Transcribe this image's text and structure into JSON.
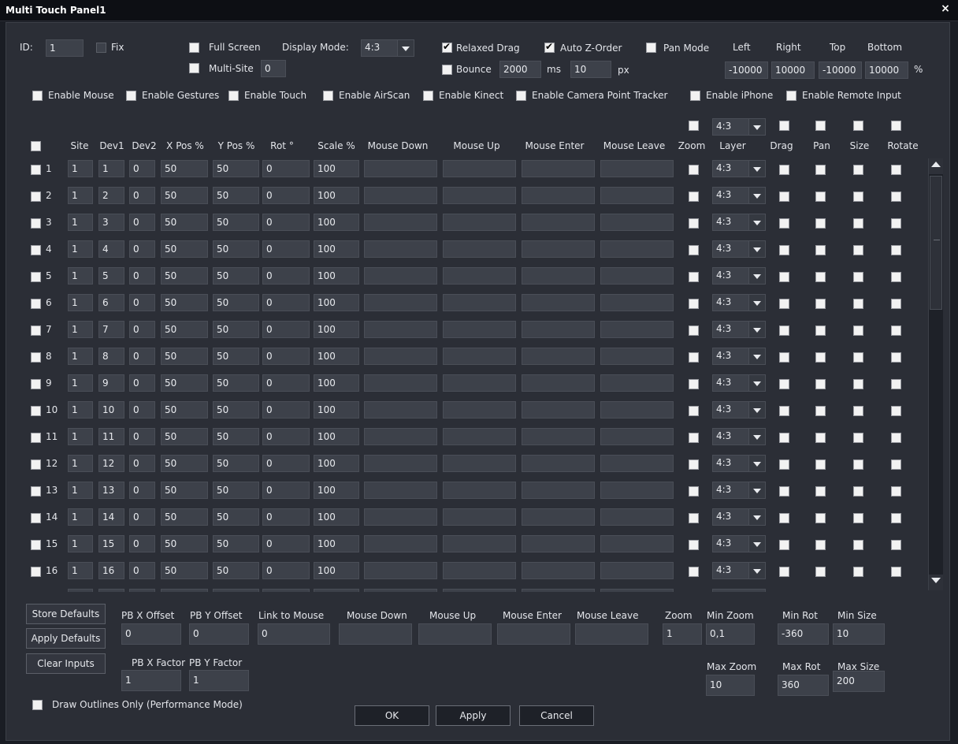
{
  "window": {
    "title": "Multi Touch Panel1",
    "close_glyph": "×"
  },
  "top": {
    "id_label": "ID:",
    "id_value": "1",
    "fix_label": "Fix",
    "full_screen_label": "Full Screen",
    "display_mode_label": "Display Mode:",
    "display_mode_value": "4:3",
    "multi_site_label": "Multi-Site",
    "multi_site_value": "0",
    "relaxed_drag_label": "Relaxed Drag",
    "relaxed_drag_checked": true,
    "auto_z_order_label": "Auto Z-Order",
    "auto_z_order_checked": true,
    "pan_mode_label": "Pan Mode",
    "bounce_label": "Bounce",
    "bounce_ms_value": "2000",
    "ms_label": "ms",
    "bounce_px_value": "10",
    "px_label": "px",
    "left_label": "Left",
    "right_label": "Right",
    "top_label": "Top",
    "bottom_label": "Bottom",
    "left_value": "-10000",
    "right_value": "10000",
    "top_value": "-10000",
    "bottom_value": "10000",
    "percent_label": "%"
  },
  "enable_options": [
    "Enable Mouse",
    "Enable Gestures",
    "Enable Touch",
    "Enable AirScan",
    "Enable Kinect",
    "Enable Camera Point Tracker",
    "Enable iPhone",
    "Enable Remote Input"
  ],
  "table": {
    "header_layer_value": "4:3",
    "columns": [
      "Site",
      "Dev1",
      "Dev2",
      "X Pos %",
      "Y Pos %",
      "Rot °",
      "Scale %",
      "Mouse Down",
      "Mouse Up",
      "Mouse Enter",
      "Mouse Leave",
      "Zoom",
      "Layer",
      "Drag",
      "Pan",
      "Size",
      "Rotate"
    ],
    "rows": [
      {
        "n": "1",
        "site": "1",
        "dev1": "1",
        "dev2": "0",
        "x": "50",
        "y": "50",
        "rot": "0",
        "scale": "100",
        "layer": "4:3"
      },
      {
        "n": "2",
        "site": "1",
        "dev1": "2",
        "dev2": "0",
        "x": "50",
        "y": "50",
        "rot": "0",
        "scale": "100",
        "layer": "4:3"
      },
      {
        "n": "3",
        "site": "1",
        "dev1": "3",
        "dev2": "0",
        "x": "50",
        "y": "50",
        "rot": "0",
        "scale": "100",
        "layer": "4:3"
      },
      {
        "n": "4",
        "site": "1",
        "dev1": "4",
        "dev2": "0",
        "x": "50",
        "y": "50",
        "rot": "0",
        "scale": "100",
        "layer": "4:3"
      },
      {
        "n": "5",
        "site": "1",
        "dev1": "5",
        "dev2": "0",
        "x": "50",
        "y": "50",
        "rot": "0",
        "scale": "100",
        "layer": "4:3"
      },
      {
        "n": "6",
        "site": "1",
        "dev1": "6",
        "dev2": "0",
        "x": "50",
        "y": "50",
        "rot": "0",
        "scale": "100",
        "layer": "4:3"
      },
      {
        "n": "7",
        "site": "1",
        "dev1": "7",
        "dev2": "0",
        "x": "50",
        "y": "50",
        "rot": "0",
        "scale": "100",
        "layer": "4:3"
      },
      {
        "n": "8",
        "site": "1",
        "dev1": "8",
        "dev2": "0",
        "x": "50",
        "y": "50",
        "rot": "0",
        "scale": "100",
        "layer": "4:3"
      },
      {
        "n": "9",
        "site": "1",
        "dev1": "9",
        "dev2": "0",
        "x": "50",
        "y": "50",
        "rot": "0",
        "scale": "100",
        "layer": "4:3"
      },
      {
        "n": "10",
        "site": "1",
        "dev1": "10",
        "dev2": "0",
        "x": "50",
        "y": "50",
        "rot": "0",
        "scale": "100",
        "layer": "4:3"
      },
      {
        "n": "11",
        "site": "1",
        "dev1": "11",
        "dev2": "0",
        "x": "50",
        "y": "50",
        "rot": "0",
        "scale": "100",
        "layer": "4:3"
      },
      {
        "n": "12",
        "site": "1",
        "dev1": "12",
        "dev2": "0",
        "x": "50",
        "y": "50",
        "rot": "0",
        "scale": "100",
        "layer": "4:3"
      },
      {
        "n": "13",
        "site": "1",
        "dev1": "13",
        "dev2": "0",
        "x": "50",
        "y": "50",
        "rot": "0",
        "scale": "100",
        "layer": "4:3"
      },
      {
        "n": "14",
        "site": "1",
        "dev1": "14",
        "dev2": "0",
        "x": "50",
        "y": "50",
        "rot": "0",
        "scale": "100",
        "layer": "4:3"
      },
      {
        "n": "15",
        "site": "1",
        "dev1": "15",
        "dev2": "0",
        "x": "50",
        "y": "50",
        "rot": "0",
        "scale": "100",
        "layer": "4:3"
      },
      {
        "n": "16",
        "site": "1",
        "dev1": "16",
        "dev2": "0",
        "x": "50",
        "y": "50",
        "rot": "0",
        "scale": "100",
        "layer": "4:3"
      }
    ]
  },
  "bottom": {
    "store_defaults": "Store Defaults",
    "apply_defaults": "Apply Defaults",
    "clear_inputs": "Clear Inputs",
    "pbx_offset_label": "PB X Offset",
    "pbx_offset_value": "0",
    "pby_offset_label": "PB Y Offset",
    "pby_offset_value": "0",
    "link_to_mouse_label": "Link to Mouse",
    "link_to_mouse_value": "0",
    "mouse_down_label": "Mouse Down",
    "mouse_up_label": "Mouse Up",
    "mouse_enter_label": "Mouse Enter",
    "mouse_leave_label": "Mouse Leave",
    "zoom_label": "Zoom",
    "zoom_value": "1",
    "min_zoom_label": "Min Zoom",
    "min_zoom_value": "0,1",
    "max_zoom_label": "Max Zoom",
    "max_zoom_value": "10",
    "min_rot_label": "Min Rot",
    "min_rot_value": "-360",
    "max_rot_label": "Max Rot",
    "max_rot_value": "360",
    "min_size_label": "Min Size",
    "min_size_value": "10",
    "max_size_label": "Max Size",
    "max_size_value": "200",
    "pbx_factor_label": "PB X Factor",
    "pbx_factor_value": "1",
    "pby_factor_label": "PB Y Factor",
    "pby_factor_value": "1",
    "draw_outlines_label": "Draw Outlines Only (Performance Mode)",
    "ok": "OK",
    "apply": "Apply",
    "cancel": "Cancel"
  }
}
